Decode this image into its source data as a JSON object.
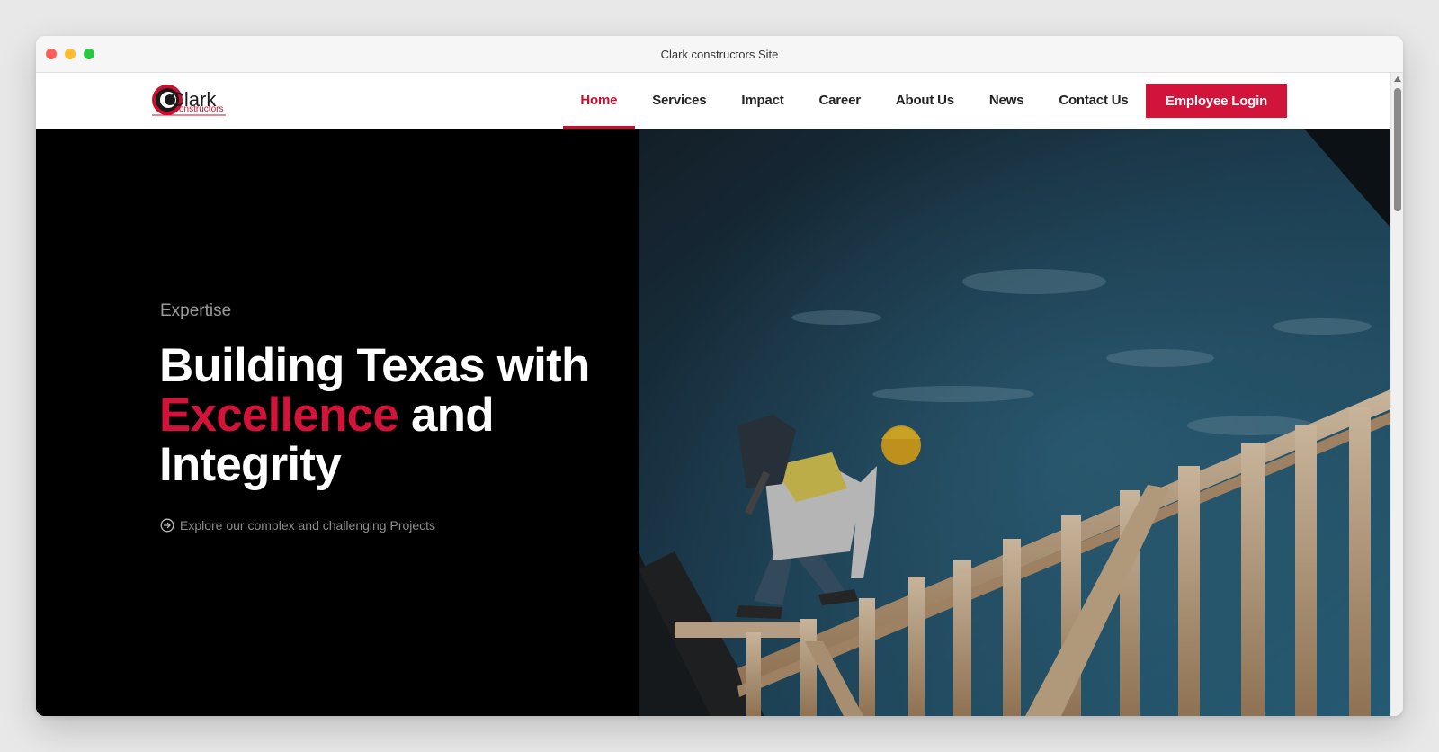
{
  "window": {
    "title": "Clark constructors Site"
  },
  "nav": {
    "logo": {
      "text_main": "Clark",
      "text_sub": "onstructors",
      "icon": "clark-logo"
    },
    "items": [
      {
        "label": "Home",
        "active": true
      },
      {
        "label": "Services",
        "active": false
      },
      {
        "label": "Impact",
        "active": false
      },
      {
        "label": "Career",
        "active": false
      },
      {
        "label": "About Us",
        "active": false
      },
      {
        "label": "News",
        "active": false
      },
      {
        "label": "Contact Us",
        "active": false
      }
    ],
    "login_label": "Employee Login"
  },
  "hero": {
    "eyebrow": "Expertise",
    "headline_line1": "Building Texas with",
    "headline_accent": "Excellence",
    "headline_and": " and",
    "headline_line3": "Integrity",
    "cta_label": "Explore our complex and challenging Projects",
    "cta_icon": "arrow-circle-right-icon",
    "image_subject": "construction worker on wooden roof framing against blue sky"
  },
  "colors": {
    "brand_red": "#d2143a",
    "nav_active": "#c8102e",
    "hero_bg": "#000000"
  }
}
